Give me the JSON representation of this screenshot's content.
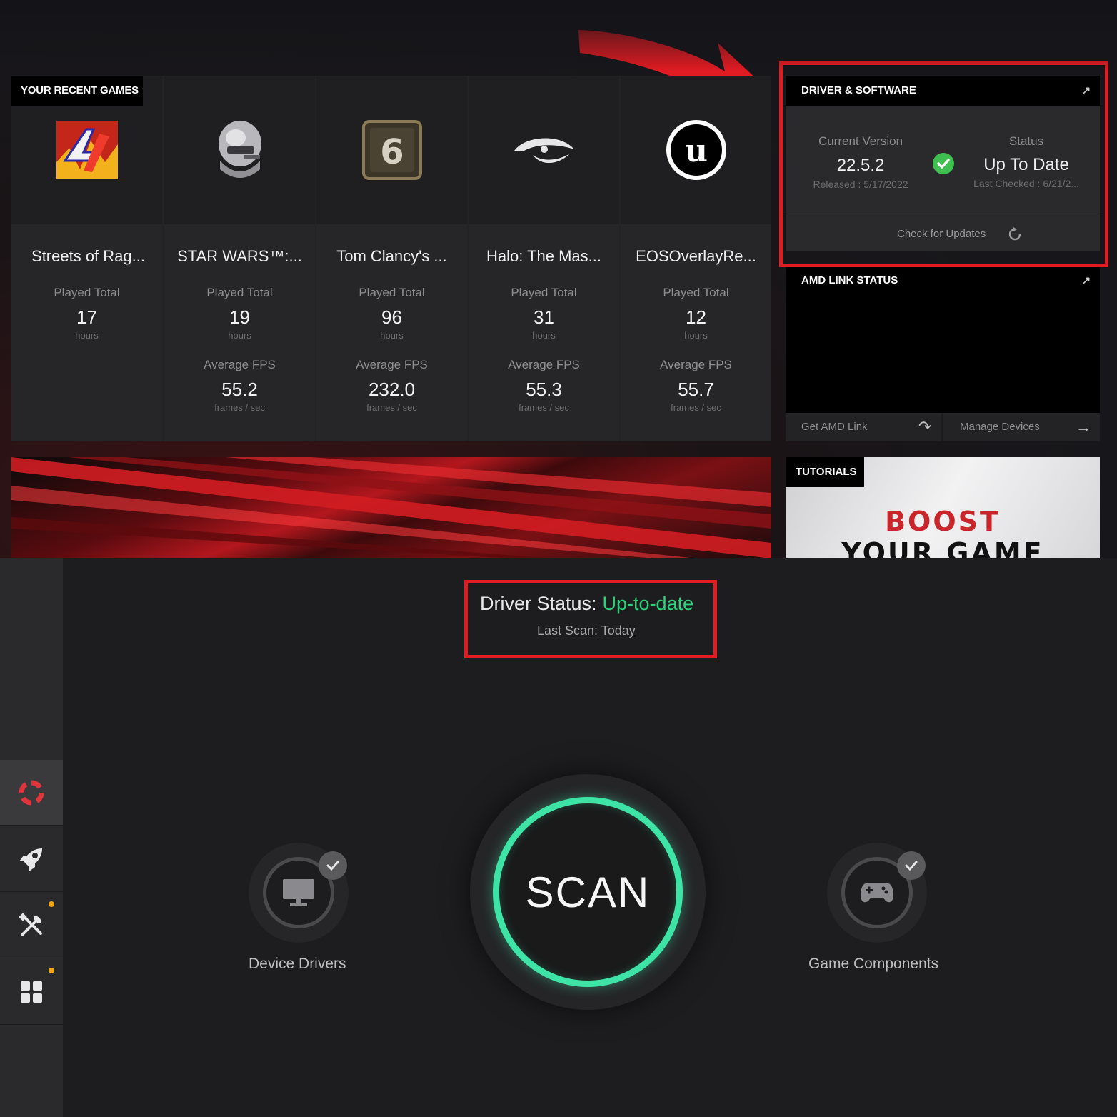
{
  "recent_games": {
    "header": "YOUR RECENT GAMES",
    "played_label": "Played Total",
    "hours_unit": "hours",
    "fps_label": "Average FPS",
    "fps_unit": "frames / sec",
    "games": [
      {
        "name": "Streets of Rag...",
        "hours": "17",
        "fps": null,
        "icon": "streets-of-rage-icon"
      },
      {
        "name": "STAR WARS™:...",
        "hours": "19",
        "fps": "55.2",
        "icon": "star-wars-helmet-icon"
      },
      {
        "name": "Tom Clancy's ...",
        "hours": "96",
        "fps": "232.0",
        "icon": "rainbow-six-icon"
      },
      {
        "name": "Halo: The Mas...",
        "hours": "31",
        "fps": "55.3",
        "icon": "halo-icon"
      },
      {
        "name": "EOSOverlayRe...",
        "hours": "12",
        "fps": "55.7",
        "icon": "unreal-engine-icon"
      }
    ]
  },
  "driver_software": {
    "title": "DRIVER & SOFTWARE",
    "current_version_label": "Current Version",
    "current_version": "22.5.2",
    "released": "Released : 5/17/2022",
    "status_label": "Status",
    "status": "Up To Date",
    "last_checked": "Last Checked : 6/21/2...",
    "check_updates": "Check for Updates"
  },
  "amd_link": {
    "title": "AMD LINK STATUS",
    "get_link": "Get AMD Link",
    "manage_devices": "Manage Devices"
  },
  "tutorials": {
    "title": "TUTORIALS",
    "line1": "BOOST",
    "line2": "YOUR GAME"
  },
  "driver_booster": {
    "status_label": "Driver Status:",
    "status_value": "Up-to-date",
    "last_scan": "Last Scan: Today",
    "scan_button": "SCAN",
    "device_drivers": "Device Drivers",
    "game_components": "Game Components"
  },
  "colors": {
    "highlight_red": "#e11b22",
    "status_green": "#2fd07b",
    "scan_ring": "#3ee3a6",
    "notification_dot": "#f0a81b"
  }
}
